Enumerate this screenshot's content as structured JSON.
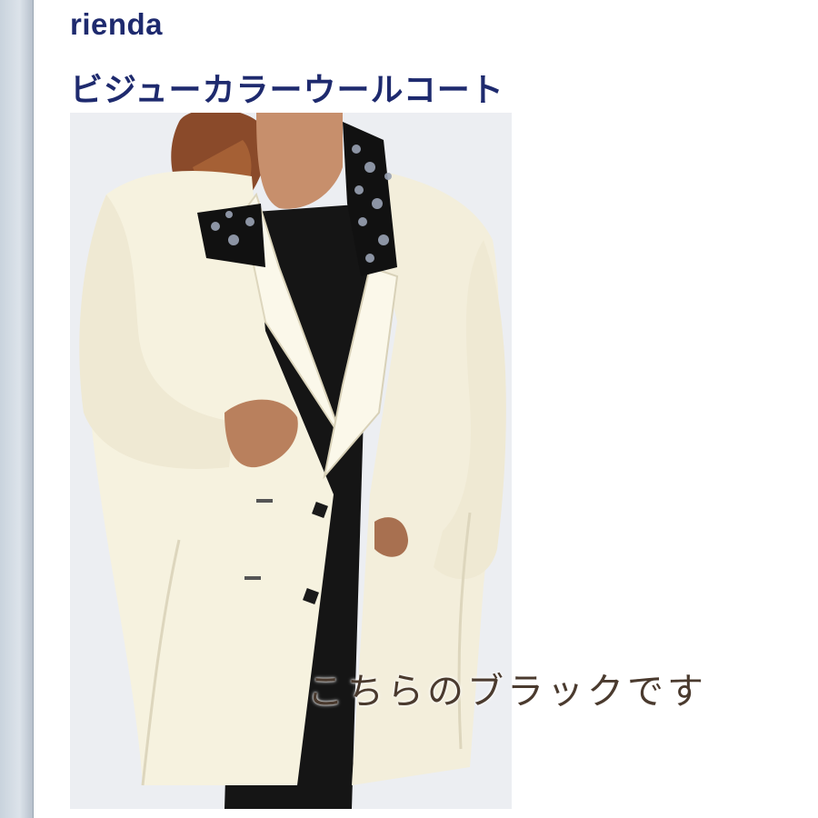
{
  "product": {
    "brand": "rienda",
    "title": "ビジューカラーウールコート"
  },
  "photo": {
    "caption": "こちらのブラックです"
  },
  "colors": {
    "title_text": "#1e2a6e",
    "coat": "#f6f2df",
    "inner": "#1a1a1a",
    "caption_text": "#4a3a2e"
  }
}
